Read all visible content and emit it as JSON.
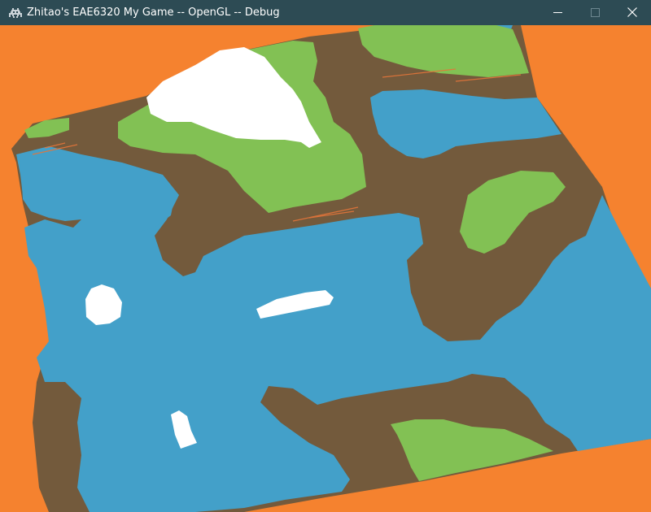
{
  "window": {
    "title": "Zhitao's EAE6320 My Game -- OpenGL -- Debug",
    "app_icon": "space-invader-icon",
    "controls": {
      "minimize_icon": "minimize-icon",
      "maximize_icon": "maximize-icon",
      "close_icon": "close-icon"
    }
  },
  "scene": {
    "description_colors": {
      "background": "#f5822f",
      "water": "#43a0c9",
      "dirt": "#735a3c",
      "grass": "#82c154",
      "snow": "#ffffff",
      "titlebar": "#2d4b54"
    }
  }
}
